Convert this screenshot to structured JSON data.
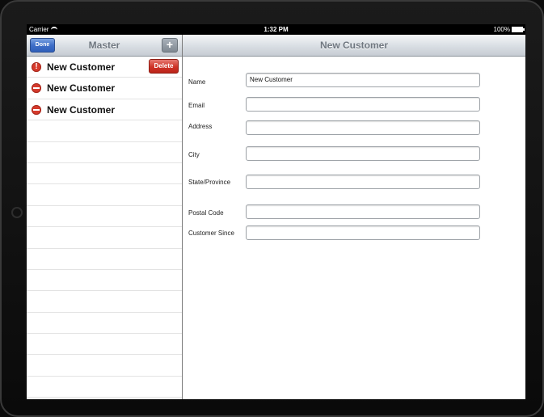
{
  "status_bar": {
    "carrier": "Carrier",
    "time": "1:32 PM",
    "battery": "100%"
  },
  "master": {
    "title": "Master",
    "done_label": "Done",
    "add_label": "+",
    "rows": [
      {
        "label": "New Customer",
        "delete_label": "Delete"
      },
      {
        "label": "New Customer"
      },
      {
        "label": "New Customer"
      }
    ]
  },
  "detail": {
    "title": "New Customer",
    "fields": [
      {
        "label": "Name",
        "value": "New Customer"
      },
      {
        "label": "Email",
        "value": ""
      },
      {
        "label": "Address",
        "value": ""
      },
      {
        "label": "City",
        "value": ""
      },
      {
        "label": "State/Province",
        "value": ""
      },
      {
        "label": "Postal Code",
        "value": ""
      },
      {
        "label": "Customer Since",
        "value": ""
      }
    ]
  },
  "colors": {
    "delete": "#cf3327",
    "done": "#3f6fc8"
  }
}
